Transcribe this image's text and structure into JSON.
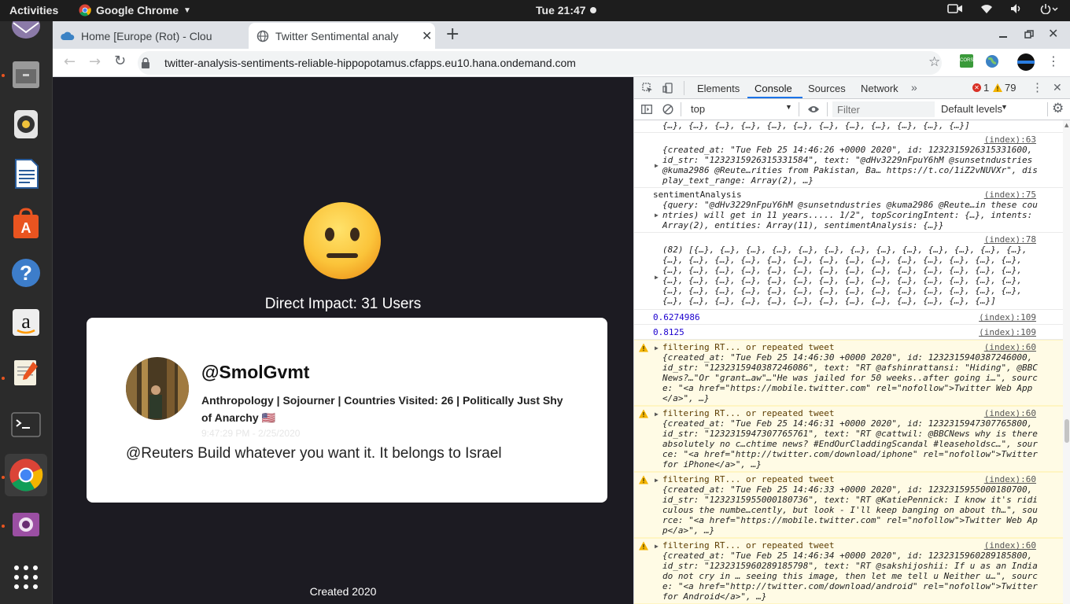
{
  "topbar": {
    "activities": "Activities",
    "app_name": "Google Chrome",
    "clock": "Tue 21:47"
  },
  "dock": {
    "items": [
      "mail-icon",
      "files-icon",
      "rhythmbox-icon",
      "writer-icon",
      "software-icon",
      "help-icon",
      "amazon-icon",
      "text-editor-icon",
      "terminal-icon",
      "chrome-icon",
      "screenshot-icon",
      "apps-grid-icon"
    ]
  },
  "browser": {
    "tabs": [
      {
        "title": "Home [Europe (Rot) - Clou"
      },
      {
        "title": "Twitter Sentimental analy"
      }
    ],
    "url": "twitter-analysis-sentiments-reliable-hippopotamus.cfapps.eu10.hana.ondemand.com",
    "extension_label": "CORS"
  },
  "page": {
    "impact_text": "Direct Impact: 31 Users",
    "card": {
      "handle": "@SmolGvmt",
      "bio": "Anthropology | Sojourner | Countries Visited: 26 | Politically Just Shy of Anarchy 🇺🇸",
      "timestamp": "9:47:29 PM - 2/25/2020",
      "tweet": "@Reuters Build whatever you want it. It belongs to Israel"
    },
    "footer": "Created 2020"
  },
  "devtools": {
    "tabs": [
      "Elements",
      "Console",
      "Sources",
      "Network"
    ],
    "active_tab": "Console",
    "errors": "1",
    "warnings": "79",
    "context": "top",
    "filter_placeholder": "Filter",
    "levels": "Default levels",
    "entries": [
      {
        "src": "",
        "body": "{…}, {…}, {…}, {…}, {…}, {…}, {…}, {…}, {…}, {…}, {…}, {…}]"
      },
      {
        "src": "(index):63",
        "body": "{created_at: \"Tue Feb 25 14:46:26 +0000 2020\", id: 1232315926315331600, id_str: \"1232315926315331584\", text: \"@dHv3229nFpuY6hM @sunsetndustries @kuma2986 @Reute…rities from Pakistan, Ba… https://t.co/1iZ2vNUVXr\", display_text_range: Array(2), …}"
      },
      {
        "src": "(index):75",
        "label": "sentimentAnalysis",
        "body": "{query: \"@dHv3229nFpuY6hM @sunsetndustries @kuma2986 @Reute…in these countries) will get in 11 years..... 1/2\", topScoringIntent: {…}, intents: Array(2), entities: Array(11), sentimentAnalysis: {…}}"
      },
      {
        "src": "(index):78",
        "body": "(82) [{…}, {…}, {…}, {…}, {…}, {…}, {…}, {…}, {…}, {…}, {…}, {…}, {…}, {…}, {…}, {…}, {…}, {…}, {…}, {…}, {…}, {…}, {…}, {…}, {…}, {…}, {…}, {…}, {…}, {…}, {…}, {…}, {…}, {…}, {…}, {…}, {…}, {…}, {…}, {…}, {…}, {…}, {…}, {…}, {…}, {…}, {…}, {…}, {…}, {…}, {…}, {…}, {…}, {…}, {…}, {…}, {…}, {…}, {…}, {…}, {…}, {…}, {…}, {…}, {…}, {…}, {…}, {…}, {…}, {…}, {…}, {…}, {…}, {…}, {…}, {…}, {…}, {…}, {…}, {…}, {…}, {…}]"
      },
      {
        "src": "(index):109",
        "value": "0.6274986"
      },
      {
        "src": "(index):109",
        "value": "0.8125"
      },
      {
        "src": "(index):60",
        "label": "filtering RT... or repeated tweet",
        "body": "{created_at: \"Tue Feb 25 14:46:30 +0000 2020\", id: 1232315940387246000, id_str: \"1232315940387246086\", text: \"RT @afshinrattansi: \"Hiding\", @BBCNews?…\"Or \"grant…aw\"…\"He was jailed for 50 weeks..after going i…\", source: \"<a href=\"https://mobile.twitter.com\" rel=\"nofollow\">Twitter Web App</a>\", …}"
      },
      {
        "src": "(index):60",
        "label": "filtering RT... or repeated tweet",
        "body": "{created_at: \"Tue Feb 25 14:46:31 +0000 2020\", id: 1232315947307765800, id_str: \"1232315947307765761\", text: \"RT @cattwil: @BBCNews why is there absolutely no c…chtime news? #EndOurCladdingScandal #leaseholdsc…\", source: \"<a href=\"http://twitter.com/download/iphone\" rel=\"nofollow\">Twitter for iPhone</a>\", …}"
      },
      {
        "src": "(index):60",
        "label": "filtering RT... or repeated tweet",
        "body": "{created_at: \"Tue Feb 25 14:46:33 +0000 2020\", id: 1232315955000180700, id_str: \"1232315955000180736\", text: \"RT @KatiePennick: I know it's ridiculous the numbe…cently, but look - I'll keep banging on about th…\", source: \"<a href=\"https://mobile.twitter.com\" rel=\"nofollow\">Twitter Web App</a>\", …}"
      },
      {
        "src": "(index):60",
        "label": "filtering RT... or repeated tweet",
        "body": "{created_at: \"Tue Feb 25 14:46:34 +0000 2020\", id: 1232315960289185800, id_str: \"1232315960289185798\", text: \"RT @sakshijoshii: If u as an India do not cry in … seeing this image, then let me tell u Neither u…\", source: \"<a href=\"http://twitter.com/download/android\" rel=\"nofollow\">Twitter for Android</a>\", …}"
      }
    ]
  }
}
